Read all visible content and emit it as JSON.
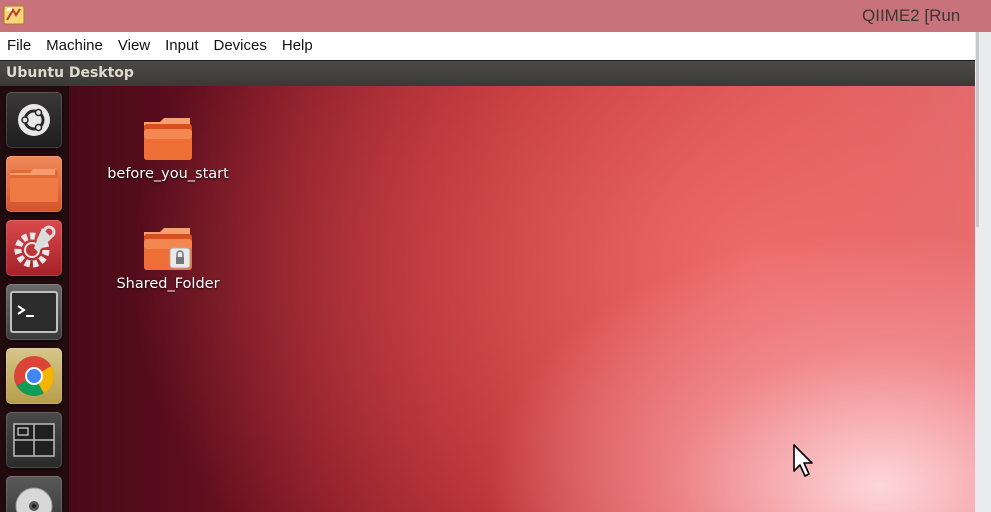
{
  "window": {
    "title": "QIIME2 [Run",
    "app_icon": "virtualbox-icon"
  },
  "menubar": {
    "items": [
      "File",
      "Machine",
      "View",
      "Input",
      "Devices",
      "Help"
    ]
  },
  "guest": {
    "panel_title": "Ubuntu Desktop",
    "launcher": [
      {
        "name": "dash-home-icon"
      },
      {
        "name": "files-icon"
      },
      {
        "name": "system-settings-icon"
      },
      {
        "name": "terminal-icon"
      },
      {
        "name": "chrome-icon"
      },
      {
        "name": "workspace-switcher-icon"
      },
      {
        "name": "dvd-icon"
      }
    ],
    "desktop_icons": [
      {
        "label": "before_you_start",
        "icon": "folder-icon"
      },
      {
        "label": "Shared_Folder",
        "icon": "locked-folder-icon"
      }
    ]
  },
  "colors": {
    "titlebar": "#c8737c",
    "menubar": "#ffffff",
    "panel": "#3c3b37",
    "wallpaper_dark": "#3c0812",
    "wallpaper_light": "#ee8f95",
    "folder_orange": "#e9642d"
  }
}
